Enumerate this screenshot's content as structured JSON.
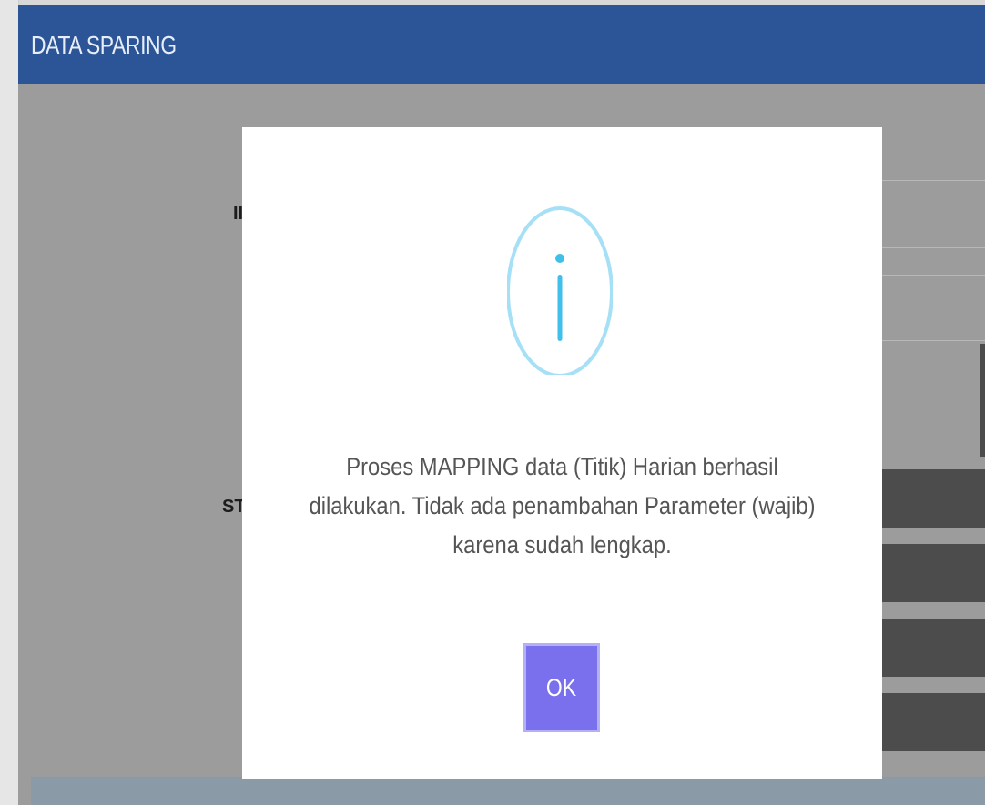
{
  "panel": {
    "title": "DATA SPARING"
  },
  "background": {
    "label_1": "II",
    "label_2": "ST."
  },
  "dialog": {
    "icon": "info-icon",
    "message": "Proses MAPPING data (Titik) Harian berhasil dilakukan. Tidak ada penambahan Parameter (wajib) karena sudah lengkap.",
    "ok_label": "OK"
  },
  "colors": {
    "header": "#2c5597",
    "overlay": "#9c9c9c",
    "icon": "#3fbfea",
    "ok_button": "#7a70ee"
  }
}
